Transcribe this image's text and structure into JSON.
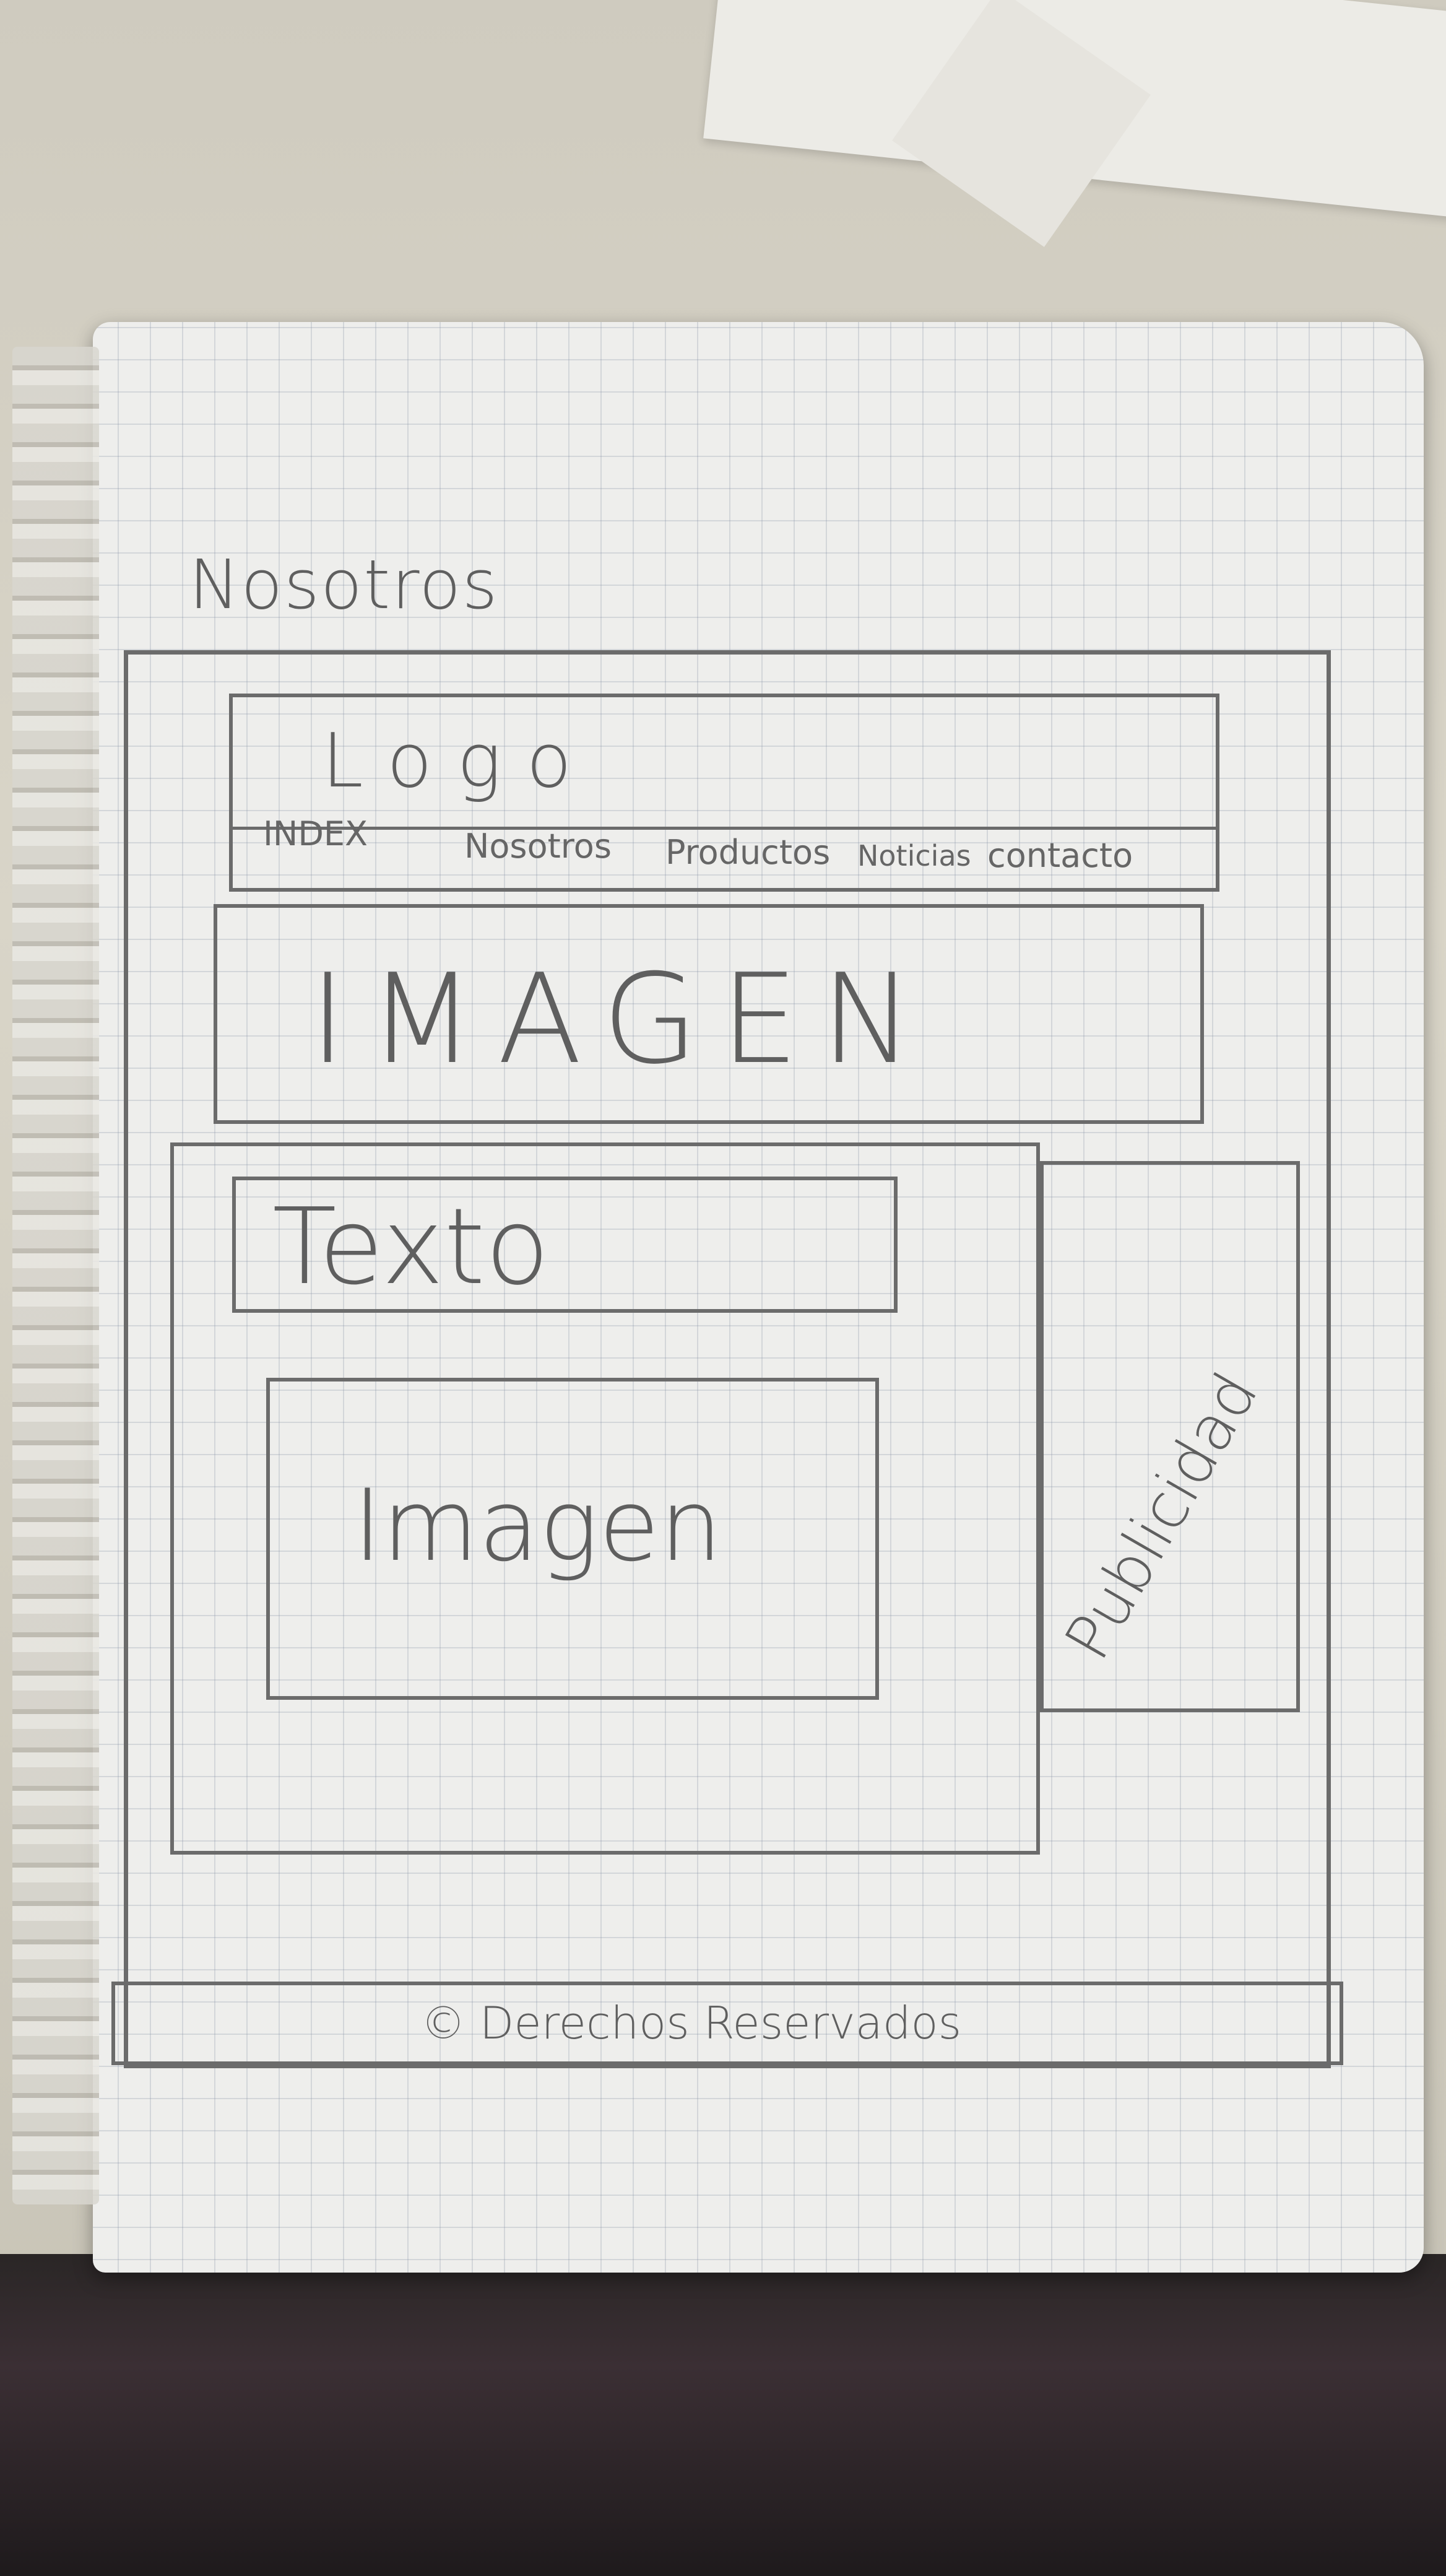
{
  "page_title": "Nosotros",
  "header": {
    "logo": "Logo",
    "nav": [
      "INDEX",
      "Nosotros",
      "Productos",
      "Noticias",
      "contacto"
    ]
  },
  "hero_image": "IMAGEN",
  "content": {
    "text": "Texto",
    "image": "Imagen"
  },
  "sidebar": {
    "ad": "Publicidad"
  },
  "footer": {
    "text": "© Derechos Reservados"
  }
}
